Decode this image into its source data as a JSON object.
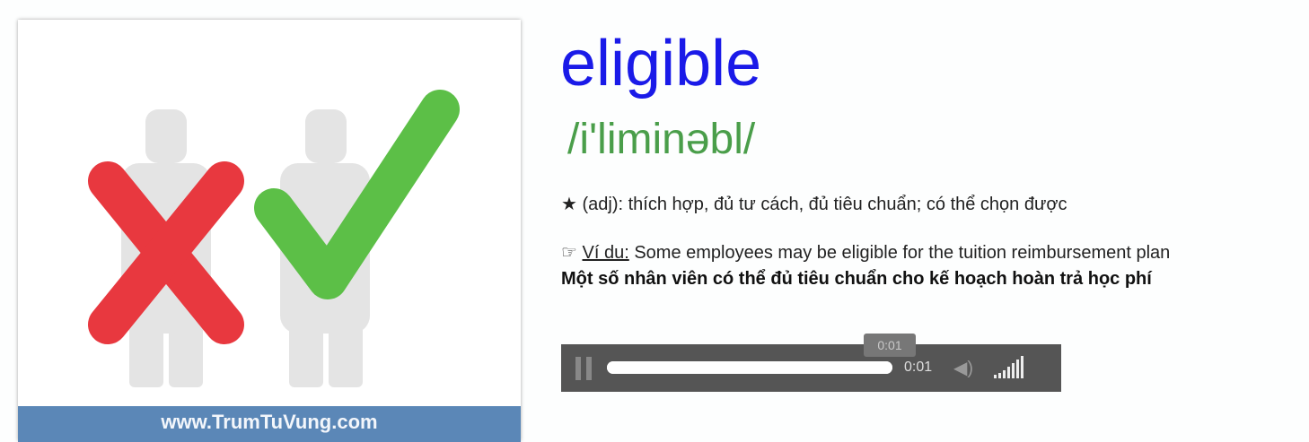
{
  "image": {
    "banner_text": "www.TrumTuVung.com",
    "colors": {
      "cross": "#e8383f",
      "check": "#5cbf47",
      "banner": "#5b87b7"
    }
  },
  "word": {
    "title": "eligible",
    "phonetic": "/i'liminəbl/",
    "title_color": "#1a1ae8",
    "phonetic_color": "#4a9e4a"
  },
  "definition": {
    "icon": "star-icon",
    "text": "(adj): thích hợp, đủ tư cách, đủ tiêu chuẩn; có thể chọn được"
  },
  "example": {
    "icon": "pointing-hand-icon",
    "label": "Ví du:",
    "text": "Some employees may be eligible for the tuition reimbursement plan",
    "translation": "Một số nhân viên có thể đủ tiêu chuẩn cho kế hoạch hoàn trả học phí"
  },
  "player": {
    "state": "playing",
    "tooltip": "0:01",
    "time": "0:01",
    "progress_percent": 100,
    "volume_percent": 100
  }
}
